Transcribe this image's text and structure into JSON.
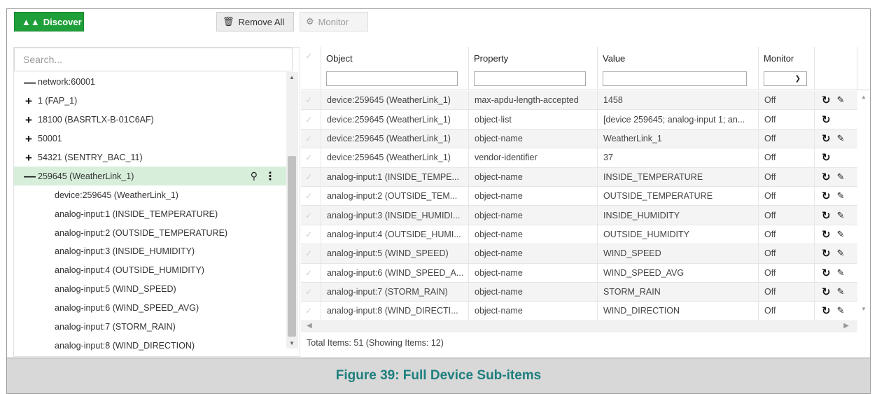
{
  "toolbar": {
    "discover_label": "Discover",
    "remove_all_label": "Remove All",
    "monitor_label": "Monitor"
  },
  "colors": {
    "accent": "#1f9f39",
    "selected_row": "#d7eedb",
    "caption_text": "#1f7f7f"
  },
  "search": {
    "placeholder": "Search..."
  },
  "tree": {
    "root": "network:60001",
    "items": [
      {
        "label": "1 (FAP_1)",
        "expanded": false
      },
      {
        "label": "18100 (BASRTLX-B-01C6AF)",
        "expanded": false
      },
      {
        "label": "50001",
        "expanded": false
      },
      {
        "label": "54321 (SENTRY_BAC_11)",
        "expanded": false
      },
      {
        "label": "259645 (WeatherLink_1)",
        "expanded": true,
        "selected": true
      }
    ],
    "children": [
      "device:259645 (WeatherLink_1)",
      "analog-input:1 (INSIDE_TEMPERATURE)",
      "analog-input:2 (OUTSIDE_TEMPERATURE)",
      "analog-input:3 (INSIDE_HUMIDITY)",
      "analog-input:4 (OUTSIDE_HUMIDITY)",
      "analog-input:5 (WIND_SPEED)",
      "analog-input:6 (WIND_SPEED_AVG)",
      "analog-input:7 (STORM_RAIN)",
      "analog-input:8 (WIND_DIRECTION)"
    ]
  },
  "grid": {
    "columns": [
      "Object",
      "Property",
      "Value",
      "Monitor"
    ],
    "rows": [
      {
        "object": "device:259645 (WeatherLink_1)",
        "property": "max-apdu-length-accepted",
        "value": "1458",
        "monitor": "Off",
        "editable": true
      },
      {
        "object": "device:259645 (WeatherLink_1)",
        "property": "object-list",
        "value": "[device 259645; analog-input 1; an...",
        "monitor": "Off",
        "editable": false
      },
      {
        "object": "device:259645 (WeatherLink_1)",
        "property": "object-name",
        "value": "WeatherLink_1",
        "monitor": "Off",
        "editable": true
      },
      {
        "object": "device:259645 (WeatherLink_1)",
        "property": "vendor-identifier",
        "value": "37",
        "monitor": "Off",
        "editable": false
      },
      {
        "object": "analog-input:1 (INSIDE_TEMPE...",
        "property": "object-name",
        "value": "INSIDE_TEMPERATURE",
        "monitor": "Off",
        "editable": true
      },
      {
        "object": "analog-input:2 (OUTSIDE_TEM...",
        "property": "object-name",
        "value": "OUTSIDE_TEMPERATURE",
        "monitor": "Off",
        "editable": true
      },
      {
        "object": "analog-input:3 (INSIDE_HUMIDI...",
        "property": "object-name",
        "value": "INSIDE_HUMIDITY",
        "monitor": "Off",
        "editable": true
      },
      {
        "object": "analog-input:4 (OUTSIDE_HUMI...",
        "property": "object-name",
        "value": "OUTSIDE_HUMIDITY",
        "monitor": "Off",
        "editable": true
      },
      {
        "object": "analog-input:5 (WIND_SPEED)",
        "property": "object-name",
        "value": "WIND_SPEED",
        "monitor": "Off",
        "editable": true
      },
      {
        "object": "analog-input:6 (WIND_SPEED_A...",
        "property": "object-name",
        "value": "WIND_SPEED_AVG",
        "monitor": "Off",
        "editable": true
      },
      {
        "object": "analog-input:7 (STORM_RAIN)",
        "property": "object-name",
        "value": "STORM_RAIN",
        "monitor": "Off",
        "editable": true
      },
      {
        "object": "analog-input:8 (WIND_DIRECTI...",
        "property": "object-name",
        "value": "WIND_DIRECTION",
        "monitor": "Off",
        "editable": true
      }
    ],
    "footer": "Total Items: 51 (Showing Items: 12)"
  },
  "caption": "Figure 39: Full Device Sub-items"
}
